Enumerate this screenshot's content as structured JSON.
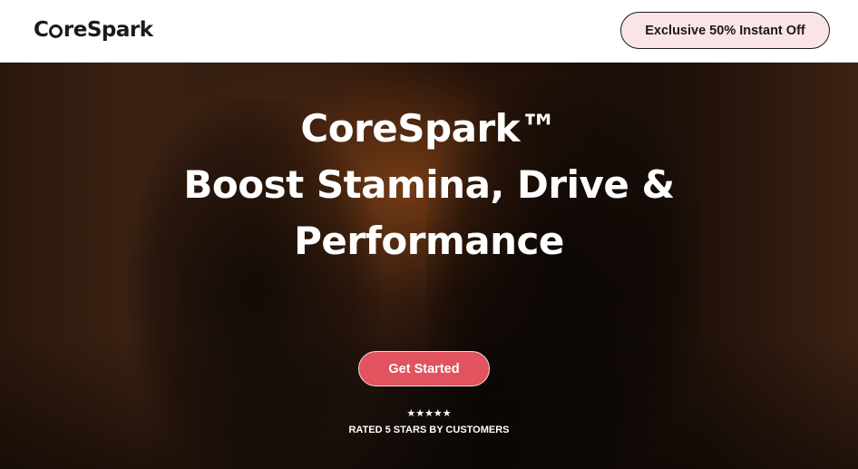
{
  "header": {
    "logo_left": "C",
    "logo_right": "reSpark",
    "offer_button_label": "Exclusive 50% Instant Off"
  },
  "hero": {
    "title_line1": "CoreSpark™",
    "title_line2": "Boost Stamina, Drive &",
    "title_line3": "Performance",
    "cta_label": "Get Started",
    "stars": "★★★★★",
    "rating_text": "RATED 5 STARS BY CUSTOMERS"
  },
  "colors": {
    "cta_background": "#e0535f",
    "offer_background": "#fbe4e6"
  }
}
